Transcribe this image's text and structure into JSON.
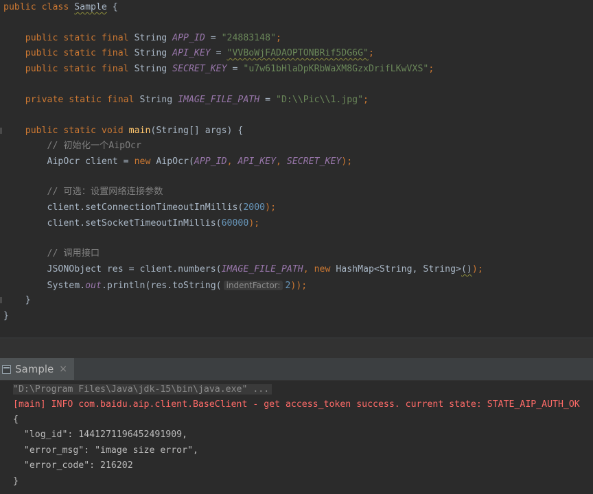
{
  "editor": {
    "lines": {
      "l1": {
        "kw": "public class ",
        "cls": "Sample",
        "rest": " {"
      },
      "l3": {
        "kw": "public static final ",
        "type": "String ",
        "name": "APP_ID",
        "eq": " = ",
        "val": "\"24883148\"",
        "end": ";"
      },
      "l4": {
        "kw": "public static final ",
        "type": "String ",
        "name": "API_KEY",
        "eq": " = ",
        "val": "\"VVBoWjFADAOPTONBRif5DG6G\"",
        "end": ";"
      },
      "l5": {
        "kw": "public static final ",
        "type": "String ",
        "name": "SECRET_KEY",
        "eq": " = ",
        "val": "\"u7w61bHlaDpKRbWaXM8GzxDrifLKwVXS\"",
        "end": ";"
      },
      "l7": {
        "kw": "private static final ",
        "type": "String ",
        "name": "IMAGE_FILE_PATH",
        "eq": " = ",
        "val": "\"D:\\\\Pic\\\\1.jpg\"",
        "end": ";"
      },
      "l9": {
        "kw": "public static void ",
        "fn": "main",
        "rest": "(String[] args) {"
      },
      "l10": {
        "comment": "// 初始化一个AipOcr"
      },
      "l11": {
        "a": "AipOcr client = ",
        "kw": "new ",
        "b": "AipOcr(",
        "c1": "APP_ID",
        "s1": ", ",
        "c2": "API_KEY",
        "s2": ", ",
        "c3": "SECRET_KEY",
        "end": ");"
      },
      "l13": {
        "comment": "// 可选：设置网络连接参数"
      },
      "l14": {
        "a": "client.setConnectionTimeoutInMillis(",
        "num": "2000",
        "end": ");"
      },
      "l15": {
        "a": "client.setSocketTimeoutInMillis(",
        "num": "60000",
        "end": ");"
      },
      "l17": {
        "comment": "// 调用接口"
      },
      "l18": {
        "a": "JSONObject res = client.numbers(",
        "c1": "IMAGE_FILE_PATH",
        "s1": ", ",
        "kw": "new ",
        "b": "HashMap<String, String>",
        "p": "()",
        "end": ");"
      },
      "l19": {
        "a": "System.",
        "st": "out",
        "b": ".println(res.toString(",
        "hint": "indentFactor:",
        "num": "2",
        "end": "));"
      },
      "l20": {
        "text": "}"
      },
      "l21": {
        "text": "}"
      }
    }
  },
  "run_panel": {
    "tab_label": "Sample",
    "close_glyph": "×"
  },
  "console": {
    "command": "\"D:\\Program Files\\Java\\jdk-15\\bin\\java.exe\" ...",
    "log": "[main] INFO com.baidu.aip.client.BaseClient - get access_token success. current state: STATE_AIP_AUTH_OK",
    "json_lines": [
      "{",
      "  \"log_id\": 1441271196452491909,",
      "  \"error_msg\": \"image size error\",",
      "  \"error_code\": 216202",
      "}"
    ]
  },
  "colors": {
    "background": "#2b2b2b",
    "keyword": "#cc7832",
    "constant": "#9876aa",
    "string": "#6a8759",
    "number": "#6897bb",
    "comment": "#808080",
    "method": "#ffc66d",
    "error_text": "#ff6b68"
  }
}
